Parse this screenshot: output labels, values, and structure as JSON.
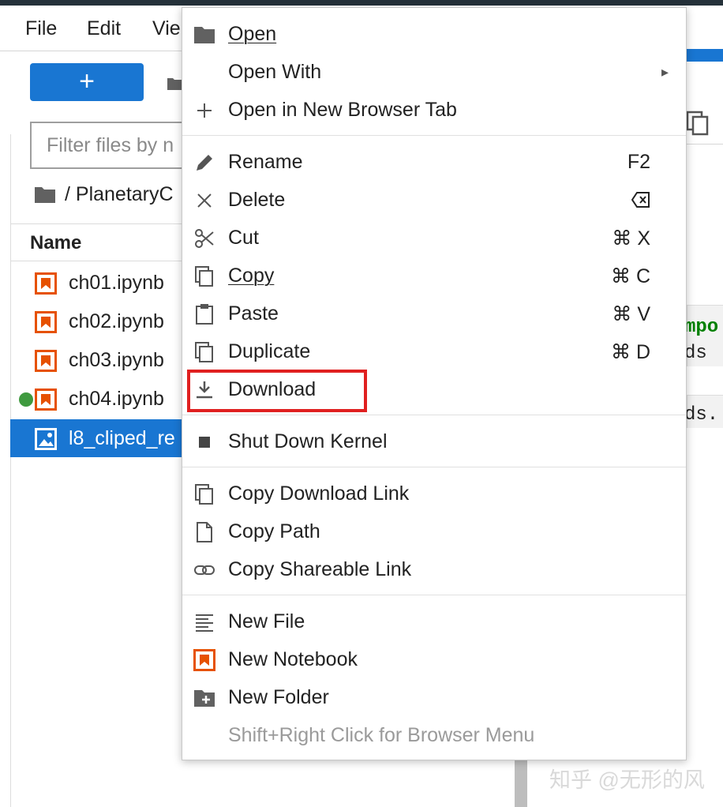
{
  "menubar": {
    "file": "File",
    "edit": "Edit",
    "view": "Vie"
  },
  "filebrowser": {
    "new_label": "+",
    "filter_placeholder": "Filter files by n",
    "breadcrumb": "/ PlanetaryC",
    "name_header": "Name",
    "files": [
      {
        "name": "ch01.ipynb"
      },
      {
        "name": "ch02.ipynb"
      },
      {
        "name": "ch03.ipynb"
      },
      {
        "name": "ch04.ipynb",
        "running": true
      },
      {
        "name": "l8_cliped_re",
        "selected": true
      }
    ]
  },
  "context_menu": {
    "open": "Open",
    "open_with": "Open With",
    "open_new_tab": "Open in New Browser Tab",
    "rename": "Rename",
    "rename_shortcut": "F2",
    "delete": "Delete",
    "cut": "Cut",
    "cut_shortcut": "⌘ X",
    "copy": "Copy",
    "copy_shortcut": "⌘ C",
    "paste": "Paste",
    "paste_shortcut": "⌘ V",
    "duplicate": "Duplicate",
    "duplicate_shortcut": "⌘ D",
    "download": "Download",
    "shutdown_kernel": "Shut Down Kernel",
    "copy_download_link": "Copy Download Link",
    "copy_path": "Copy Path",
    "copy_shareable_link": "Copy Shareable Link",
    "new_file": "New File",
    "new_notebook": "New Notebook",
    "new_folder": "New Folder",
    "browser_menu_hint": "Shift+Right Click for Browser Menu"
  },
  "code_preview": {
    "line1": "mpo",
    "line2": "ds",
    "line3": "ds."
  },
  "watermark": "知乎 @无形的风",
  "colors": {
    "accent": "#1976d2",
    "notebook_orange": "#e65100",
    "highlight_red": "#e02020",
    "running_green": "#3f9a3f",
    "code_keyword_green": "#008000"
  }
}
